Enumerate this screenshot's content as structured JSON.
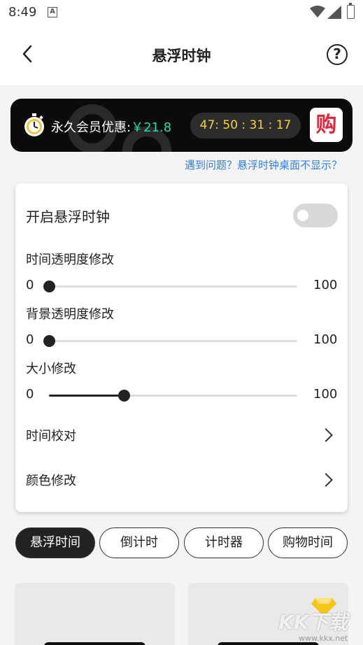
{
  "status_bar": {
    "time": "8:49",
    "notification_icon": "A"
  },
  "header": {
    "title": "悬浮时钟",
    "help_icon": "?"
  },
  "banner": {
    "promo_label": "永久会员优惠:",
    "price": "￥21.8",
    "countdown": "47: 50 : 31 : 17",
    "buy_label": "购"
  },
  "help_link": "遇到问题？悬浮时钟桌面不显示？",
  "settings": {
    "enable_label": "开启悬浮时钟",
    "enable_on": false,
    "time_opacity": {
      "label": "时间透明度修改",
      "min": "0",
      "max": "100",
      "value": 0
    },
    "bg_opacity": {
      "label": "背景透明度修改",
      "min": "0",
      "max": "100",
      "value": 0
    },
    "size": {
      "label": "大小修改",
      "min": "0",
      "max": "100",
      "value": 30
    },
    "time_calibrate_label": "时间校对",
    "color_label": "颜色修改"
  },
  "tabs": [
    {
      "label": "悬浮时间",
      "active": true
    },
    {
      "label": "倒计时",
      "active": false
    },
    {
      "label": "计时器",
      "active": false
    },
    {
      "label": "购物时间",
      "active": false
    }
  ],
  "watermark": {
    "logo": "KK下载",
    "url": "www.kkx.net"
  },
  "colors": {
    "accent_price": "#29d9a8",
    "countdown_text": "#f4d23b",
    "buy_red": "#e8253b",
    "link_blue": "#2f7ee0"
  }
}
